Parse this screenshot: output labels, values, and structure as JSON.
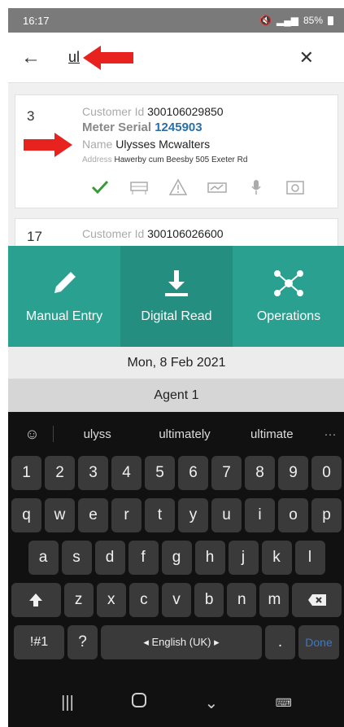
{
  "status": {
    "time": "16:17",
    "battery": "85%"
  },
  "search": {
    "query": "ul"
  },
  "results": [
    {
      "index": "3",
      "customer_id_label": "Customer Id",
      "customer_id": "300106029850",
      "meter_label": "Meter Serial",
      "meter_serial": "1245903",
      "name_label": "Name",
      "name": "Ulysses Mcwalters",
      "address_label": "Address",
      "address": "Hawerby cum Beesby 505 Exeter Rd"
    },
    {
      "index": "17",
      "customer_id_label": "Customer Id",
      "customer_id": "300106026600"
    }
  ],
  "nav": {
    "manual": "Manual Entry",
    "digital": "Digital Read",
    "operations": "Operations"
  },
  "date": "Mon, 8 Feb 2021",
  "agent": "Agent 1",
  "keyboard": {
    "suggestions": [
      "ulyss",
      "ultimately",
      "ultimate"
    ],
    "numbers": [
      "1",
      "2",
      "3",
      "4",
      "5",
      "6",
      "7",
      "8",
      "9",
      "0"
    ],
    "row1": [
      "q",
      "w",
      "e",
      "r",
      "t",
      "y",
      "u",
      "i",
      "o",
      "p"
    ],
    "row2": [
      "a",
      "s",
      "d",
      "f",
      "g",
      "h",
      "j",
      "k",
      "l"
    ],
    "row3": [
      "z",
      "x",
      "c",
      "v",
      "b",
      "n",
      "m"
    ],
    "symbols": "!#1",
    "question": "?",
    "space": "◂ English (UK) ▸",
    "period": ".",
    "done": "Done"
  },
  "colors": {
    "teal": "#2aa190",
    "teal_dark": "#248f80",
    "arrow": "#e8231f",
    "link_blue": "#2a6fa8"
  }
}
